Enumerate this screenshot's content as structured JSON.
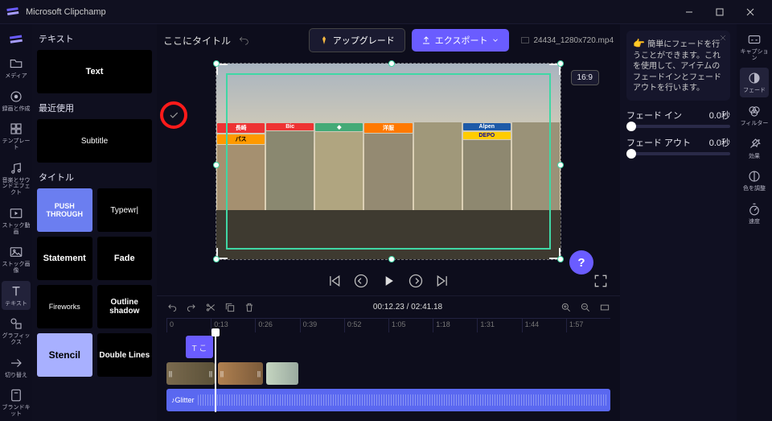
{
  "app": {
    "title": "Microsoft Clipchamp"
  },
  "left_rail": [
    {
      "label": "録画と作成"
    },
    {
      "label": "メディア"
    },
    {
      "label": "録画と作成"
    },
    {
      "label": "テンプレート"
    },
    {
      "label": "音楽とサウンドエフェクト"
    },
    {
      "label": "ストック動画"
    },
    {
      "label": "ストック画像"
    },
    {
      "label": "テキスト"
    },
    {
      "label": "グラフィックス"
    },
    {
      "label": "切り替え"
    },
    {
      "label": "ブランドキット"
    }
  ],
  "panel": {
    "section1": "テキスト",
    "section2": "最近使用",
    "section3": "タイトル",
    "items": {
      "text": "Text",
      "subtitle": "Subtitle",
      "push": "PUSH THROUGH",
      "typewr": "Typewr|",
      "statement": "Statement",
      "fade": "Fade",
      "fireworks": "Fireworks",
      "outline": "Outline shadow",
      "stencil": "Stencil",
      "double": "Double Lines"
    }
  },
  "topbar": {
    "title": "ここにタイトル",
    "upgrade": "アップグレード",
    "export": "エクスポート",
    "clipname": "24434_1280x720.mp4",
    "aspect": "16:9"
  },
  "tip": {
    "text": "簡単にフェードを行うことができます。これを使用して、アイテムのフェードインとフェードアウトを行います。"
  },
  "props": {
    "fadein_label": "フェード イン",
    "fadein_value": "0.0秒",
    "fadeout_label": "フェード アウト",
    "fadeout_value": "0.0秒"
  },
  "right_rail": [
    {
      "label": "キャプション"
    },
    {
      "label": "フェード"
    },
    {
      "label": "フィルター"
    },
    {
      "label": "効果"
    },
    {
      "label": "色を調整"
    },
    {
      "label": "速度"
    }
  ],
  "time": {
    "current": "00:12.23",
    "total": "02:41.18"
  },
  "ruler": [
    "0",
    "0:13",
    "0:26",
    "0:39",
    "0:52",
    "1:05",
    "1:18",
    "1:31",
    "1:44",
    "1:57"
  ],
  "audio_clip": "Glitter",
  "help": "?"
}
